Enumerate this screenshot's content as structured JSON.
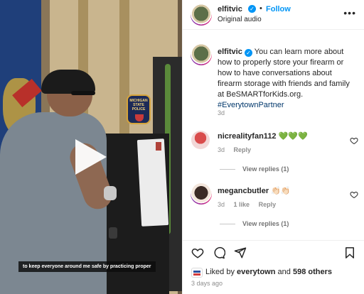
{
  "video": {
    "caption": "to keep everyone around me safe by practicing proper",
    "patch_text": "MICHIGAN STATE POLICE"
  },
  "header": {
    "username": "elfitvic",
    "separator": "•",
    "follow_label": "Follow",
    "subtitle": "Original audio",
    "more_icon": "more-horizontal-icon"
  },
  "post": {
    "username": "elfitvic",
    "caption": "You can learn more about how to properly store your firearm or how to have conversations about firearm storage with friends and family at BeSMARTforKids.org.",
    "hashtag": "#EverytownPartner",
    "time": "3d"
  },
  "comments": [
    {
      "username": "nicrealityfan112",
      "text": "💚💚💚",
      "time": "3d",
      "likes": "",
      "reply_label": "Reply",
      "view_replies": "View replies (1)"
    },
    {
      "username": "megancbutler",
      "text": "👏🏻👏🏻",
      "time": "3d",
      "likes": "1 like",
      "reply_label": "Reply",
      "view_replies": "View replies (1)"
    }
  ],
  "actions": {
    "liked_prefix": "Liked by",
    "liked_user": "everytown",
    "liked_and": "and",
    "liked_count": "598 others",
    "ago": "3 days ago"
  },
  "colors": {
    "accent": "#0095f6",
    "muted": "#8e8e8e"
  }
}
